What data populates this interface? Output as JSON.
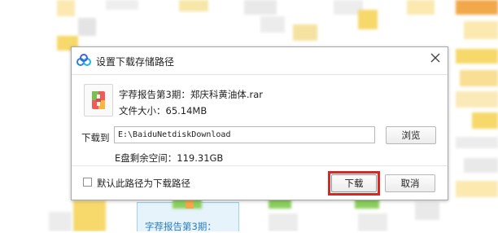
{
  "dialog": {
    "title": "设置下载存储路径",
    "file_name": "字荐报告第3期：郑庆科黄油体.rar",
    "file_size": "文件大小：65.14MB",
    "download_to_label": "下载到",
    "path_value": "E:\\BaiduNetdiskDownload",
    "browse_label": "浏览",
    "free_space": "E盘剩余空间：119.31GB",
    "default_checkbox_label": "默认此路径为下载路径",
    "download_label": "下载",
    "cancel_label": "取消"
  },
  "icons": [
    "baidu-netdisk-logo-icon",
    "close-icon",
    "rar-archive-icon"
  ],
  "colors": {
    "highlight": "#d42a26",
    "bg_yellow": "#f7d86a",
    "bg_light_yellow": "#fbe9b0",
    "bg_gray": "#e4e4e4",
    "bg_green": "#8ccf5e",
    "bg_orange": "#f2a74a"
  },
  "background": {
    "card_text": "字荐报告第3期："
  }
}
